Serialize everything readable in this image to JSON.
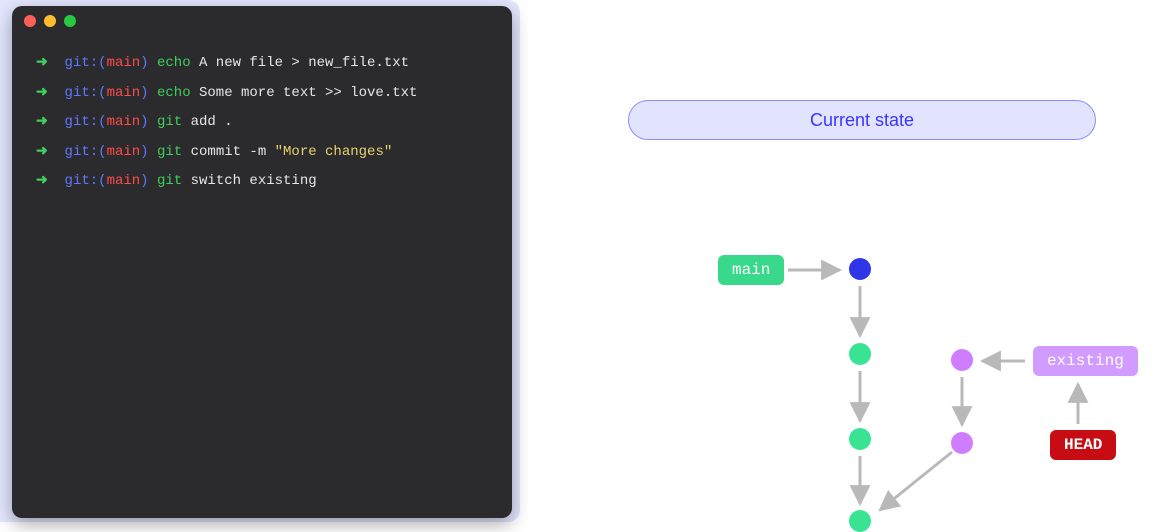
{
  "terminal": {
    "prompt": {
      "arrow": "➜",
      "git": "git:",
      "paren_open": "(",
      "branch": "main",
      "paren_close": ")"
    },
    "lines": [
      {
        "cmd": "echo",
        "rest": "A new file > new_file.txt"
      },
      {
        "cmd": "echo",
        "rest": "Some more text >> love.txt"
      },
      {
        "cmd": "git",
        "rest": "add ."
      },
      {
        "cmd": "git",
        "rest": "commit -m ",
        "string": "\"More changes\""
      },
      {
        "cmd": "git",
        "rest": "switch existing"
      }
    ]
  },
  "heading": "Current state",
  "labels": {
    "main": "main",
    "existing": "existing",
    "head": "HEAD"
  },
  "chart_data": {
    "type": "diagram",
    "description": "Git commit graph",
    "title": "Current state",
    "refs": [
      {
        "name": "main",
        "points_to": "c1"
      },
      {
        "name": "existing",
        "points_to": "b1"
      },
      {
        "name": "HEAD",
        "points_to_ref": "existing"
      }
    ],
    "nodes": [
      {
        "id": "c1",
        "color": "blue",
        "branch": "main"
      },
      {
        "id": "c2",
        "color": "green",
        "branch": "main"
      },
      {
        "id": "c3",
        "color": "green",
        "branch": "main"
      },
      {
        "id": "c4",
        "color": "green",
        "branch": "main"
      },
      {
        "id": "b1",
        "color": "purple",
        "branch": "existing"
      },
      {
        "id": "b2",
        "color": "purple",
        "branch": "existing"
      }
    ],
    "edges": [
      {
        "from": "c1",
        "to": "c2"
      },
      {
        "from": "c2",
        "to": "c3"
      },
      {
        "from": "c3",
        "to": "c4"
      },
      {
        "from": "b1",
        "to": "b2"
      },
      {
        "from": "b2",
        "to": "c4"
      }
    ]
  }
}
